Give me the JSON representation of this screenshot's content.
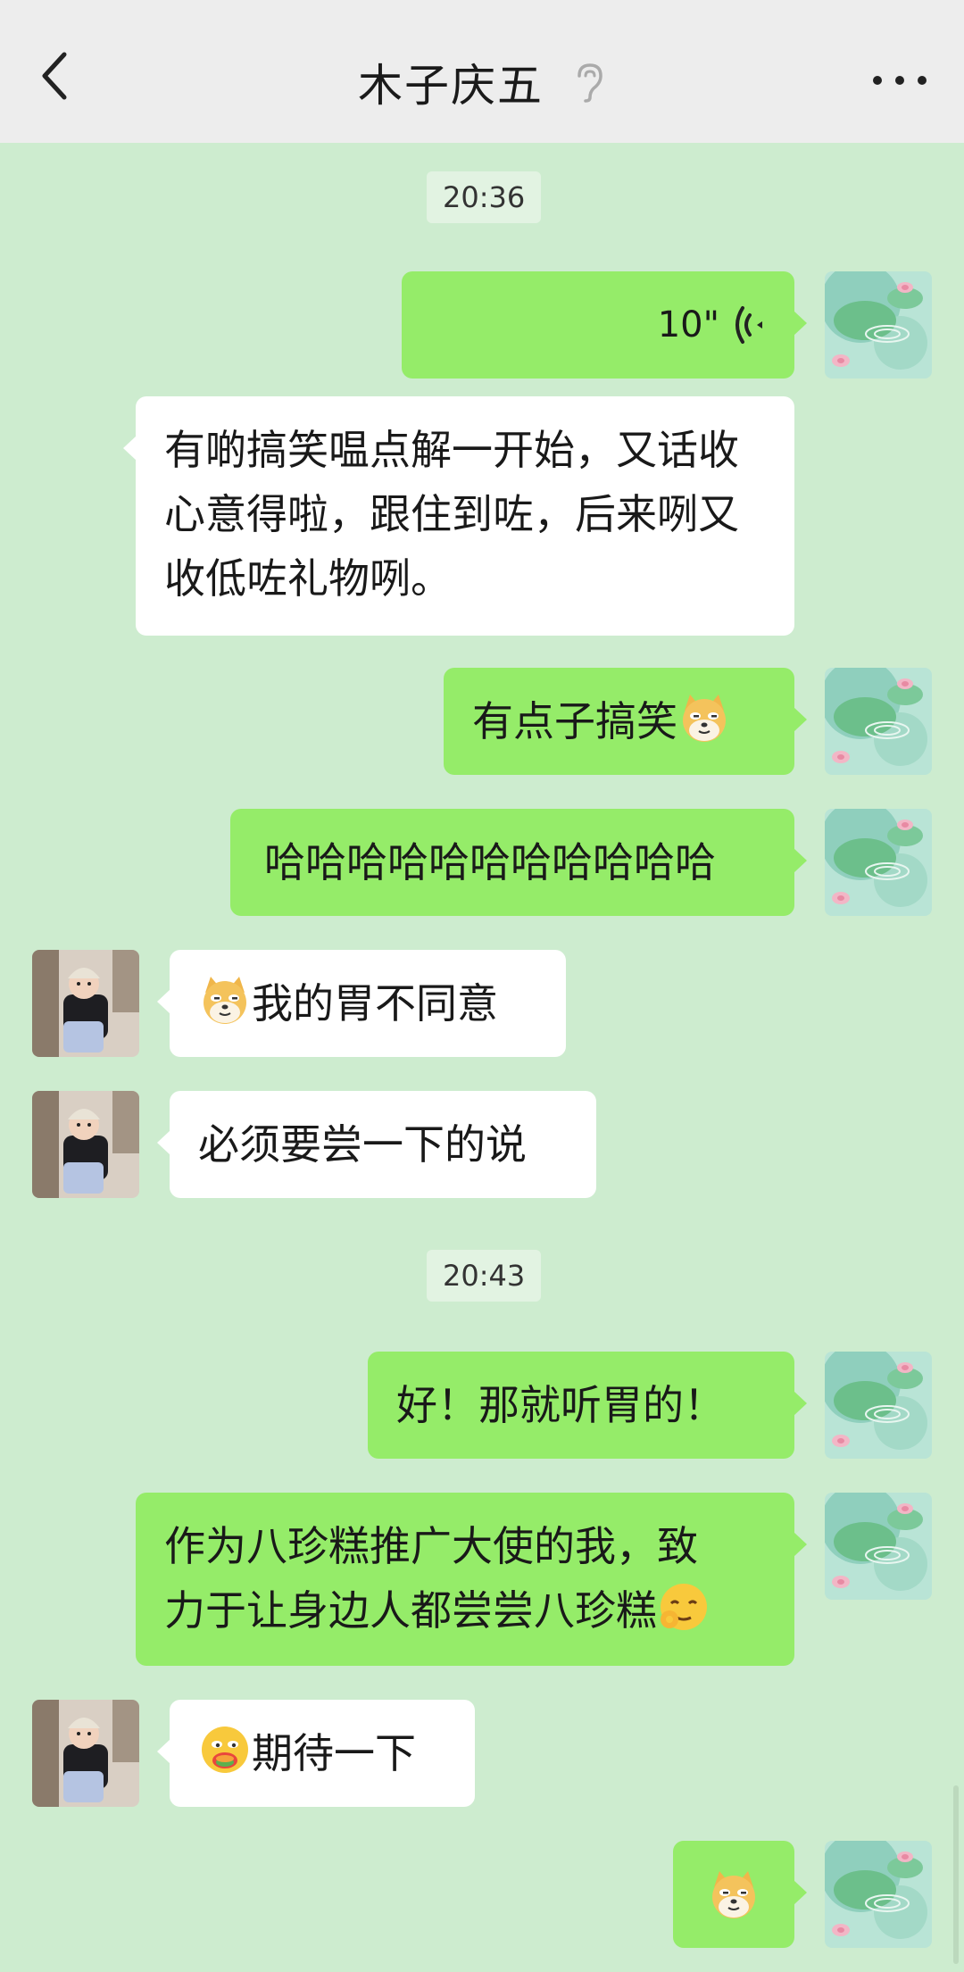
{
  "header": {
    "title": "木子庆五"
  },
  "messages": {
    "time_1": "20:36",
    "voice_duration": "10\"",
    "msg_1": "有啲搞笑嗢点解一开始，又话收心意得啦，跟住到咗，后来咧又收低咗礼物咧。",
    "msg_2": "有点子搞笑",
    "msg_3": "哈哈哈哈哈哈哈哈哈哈哈",
    "msg_4": "我的胃不同意",
    "msg_5": "必须要尝一下的说",
    "time_2": "20:43",
    "msg_6": "好！那就听胃的！",
    "msg_7_line1": "作为八珍糕推广大使的我，致",
    "msg_7_line2": "力于让身边人都尝尝八珍糕",
    "msg_8": "期待一下"
  },
  "colors": {
    "background": "#cdeccf",
    "my_bubble": "#95ec69",
    "their_bubble": "#ffffff"
  }
}
